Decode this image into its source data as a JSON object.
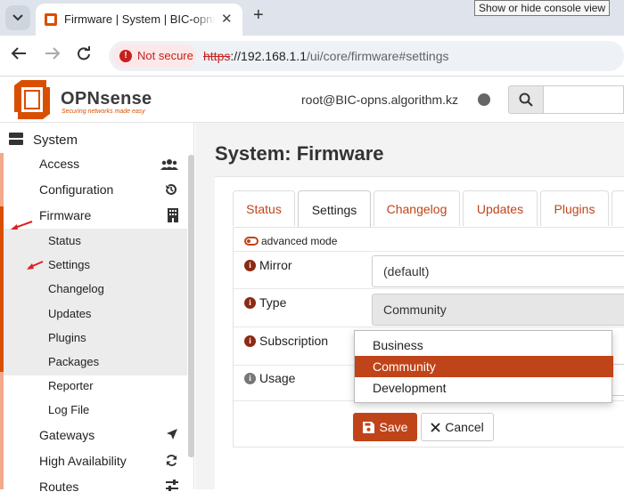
{
  "browser": {
    "tab_title": "Firmware | System | BIC-opns.algorithm.kz",
    "tab_close": "✕",
    "new_tab": "+",
    "tooltip": "Show or hide console view",
    "not_secure": "Not secure",
    "url_scheme": "https",
    "url_host": "://192.168.1.1",
    "url_path": "/ui/core/firmware#settings"
  },
  "header": {
    "logo_name": "OPNsense",
    "logo_tagline": "Securing networks made easy",
    "user": "root@BIC-opns.algorithm.kz"
  },
  "sidebar": {
    "section": "System",
    "items": [
      {
        "label": "Access",
        "icon": "users-icon"
      },
      {
        "label": "Configuration",
        "icon": "history-icon"
      },
      {
        "label": "Firmware",
        "icon": "building-icon"
      }
    ],
    "firmware_sub": [
      "Status",
      "Settings",
      "Changelog",
      "Updates",
      "Plugins",
      "Packages",
      "Reporter",
      "Log File"
    ],
    "items_after": [
      {
        "label": "Gateways",
        "icon": "location-arrow-icon"
      },
      {
        "label": "High Availability",
        "icon": "refresh-icon"
      },
      {
        "label": "Routes",
        "icon": "sliders-icon"
      }
    ]
  },
  "main": {
    "title": "System: Firmware",
    "tabs": [
      "Status",
      "Settings",
      "Changelog",
      "Updates",
      "Plugins"
    ],
    "active_tab": "Settings",
    "advanced_mode": "advanced mode",
    "fields": {
      "mirror": {
        "label": "Mirror",
        "value": "(default)"
      },
      "type": {
        "label": "Type",
        "value": "Community"
      },
      "subscription": {
        "label": "Subscription"
      },
      "usage": {
        "label": "Usage"
      }
    },
    "type_options": [
      "Business",
      "Community",
      "Development"
    ],
    "type_selected": "Community",
    "save": "Save",
    "cancel": "Cancel"
  },
  "colors": {
    "accent": "#c0441a",
    "brand": "#d94f00"
  }
}
